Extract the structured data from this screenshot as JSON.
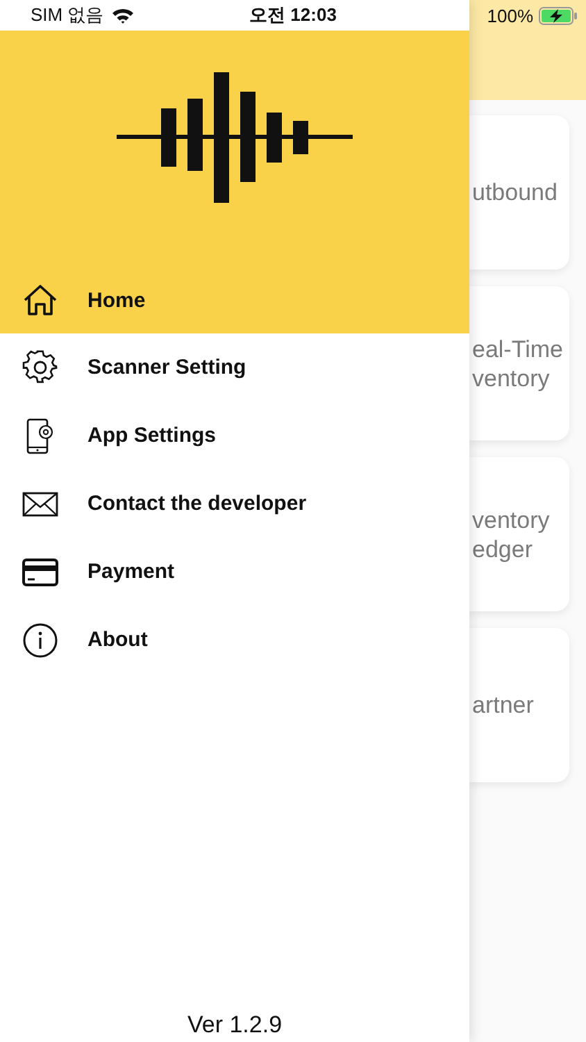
{
  "status_bar": {
    "carrier": "SIM 없음",
    "time": "오전 12:03",
    "battery": "100%"
  },
  "drawer": {
    "menu": [
      {
        "label": "Home",
        "selected": true
      },
      {
        "label": "Scanner Setting",
        "selected": false
      },
      {
        "label": "App Settings",
        "selected": false
      },
      {
        "label": "Contact the developer",
        "selected": false
      },
      {
        "label": "Payment",
        "selected": false
      },
      {
        "label": "About",
        "selected": false
      }
    ],
    "version": "Ver 1.2.9"
  },
  "background_cards": [
    {
      "lines": [
        "utbound"
      ]
    },
    {
      "lines": [
        "eal-Time",
        "ventory"
      ]
    },
    {
      "lines": [
        "ventory",
        "edger"
      ]
    },
    {
      "lines": [
        "artner"
      ]
    }
  ]
}
